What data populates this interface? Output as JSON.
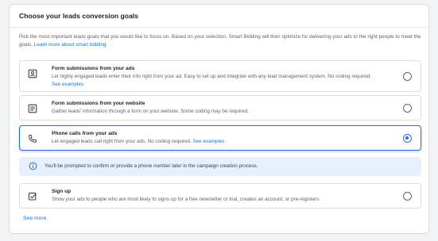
{
  "card": {
    "title": "Choose your leads conversion goals",
    "description": "Pick the most important leads goals that you would like to focus on. Based on your selection, Smart Bidding will then optimize for delivering your ads to the right people to meet the goals.",
    "learn_more": "Learn more about smart bidding"
  },
  "options": [
    {
      "icon": "form-icon",
      "title": "Form submissions from your ads",
      "subtitle": "Let highly engaged leads enter their info right from your ad. Easy to set up and integrate with any lead management system. No coding required.",
      "link": "See examples",
      "selected": false
    },
    {
      "icon": "website-form-icon",
      "title": "Form submissions from your website",
      "subtitle": "Gather leads' information through a form on your website. Some coding may be required.",
      "selected": false
    },
    {
      "icon": "phone-icon",
      "title": "Phone calls from your ads",
      "subtitle": "Let engaged leads call right from your ads. No coding required.",
      "link": "See examples",
      "selected": true
    },
    {
      "icon": "signup-checkbox-icon",
      "title": "Sign up",
      "subtitle": "Show your ads to people who are most likely to signs up for a free newsletter or trial, creates an account, or pre-registers",
      "selected": false
    }
  ],
  "info_banner": {
    "icon": "info-icon",
    "text": "You'll be prompted to confirm or provide a phone number later in the campaign creation process."
  },
  "see_more": "See more",
  "colors": {
    "accent": "#1a73e8",
    "info_bg": "#e8f0fe",
    "border": "#dadce0",
    "page_bg": "#f1f3f4"
  }
}
